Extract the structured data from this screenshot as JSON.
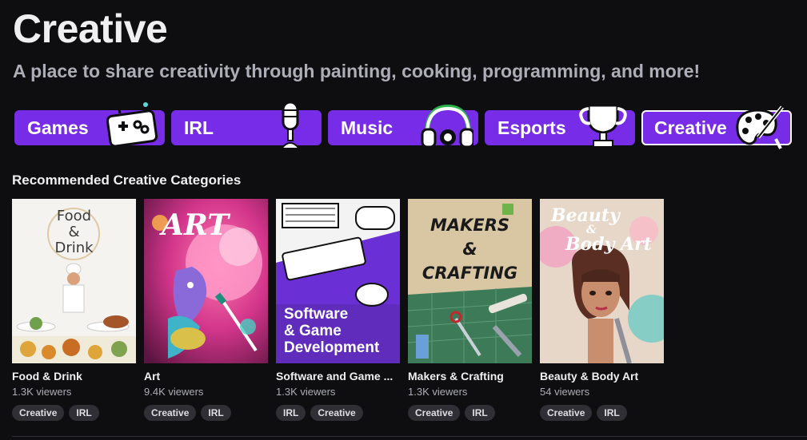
{
  "header": {
    "title": "Creative",
    "subtitle": "A place to share creativity through painting, cooking, programming, and more!"
  },
  "tabs": [
    {
      "label": "Games",
      "icon": "gamepad-icon",
      "active": false
    },
    {
      "label": "IRL",
      "icon": "microphone-icon",
      "active": false
    },
    {
      "label": "Music",
      "icon": "headphones-icon",
      "active": false
    },
    {
      "label": "Esports",
      "icon": "trophy-icon",
      "active": false
    },
    {
      "label": "Creative",
      "icon": "palette-icon",
      "active": true
    }
  ],
  "section": {
    "title": "Recommended Creative Categories"
  },
  "cards": [
    {
      "name": "Food & Drink",
      "viewers": "1.3K viewers",
      "tags": [
        "Creative",
        "IRL"
      ],
      "art_text": [
        "Food",
        "&",
        "Drink"
      ]
    },
    {
      "name": "Art",
      "viewers": "9.4K viewers",
      "tags": [
        "Creative",
        "IRL"
      ],
      "art_text": [
        "ART"
      ]
    },
    {
      "name": "Software and Game ...",
      "viewers": "1.3K viewers",
      "tags": [
        "IRL",
        "Creative"
      ],
      "art_text": [
        "Software",
        "& Game",
        "Development"
      ]
    },
    {
      "name": "Makers & Crafting",
      "viewers": "1.3K viewers",
      "tags": [
        "Creative",
        "IRL"
      ],
      "art_text": [
        "MAKERS",
        "&",
        "CRAFTING"
      ]
    },
    {
      "name": "Beauty & Body Art",
      "viewers": "54 viewers",
      "tags": [
        "Creative",
        "IRL"
      ],
      "art_text": [
        "Beauty",
        "&",
        "Body Art"
      ]
    }
  ],
  "colors": {
    "background": "#0e0e10",
    "accent": "#772ce8",
    "tag_bg": "#2f2f35",
    "muted_text": "#adadb8"
  }
}
